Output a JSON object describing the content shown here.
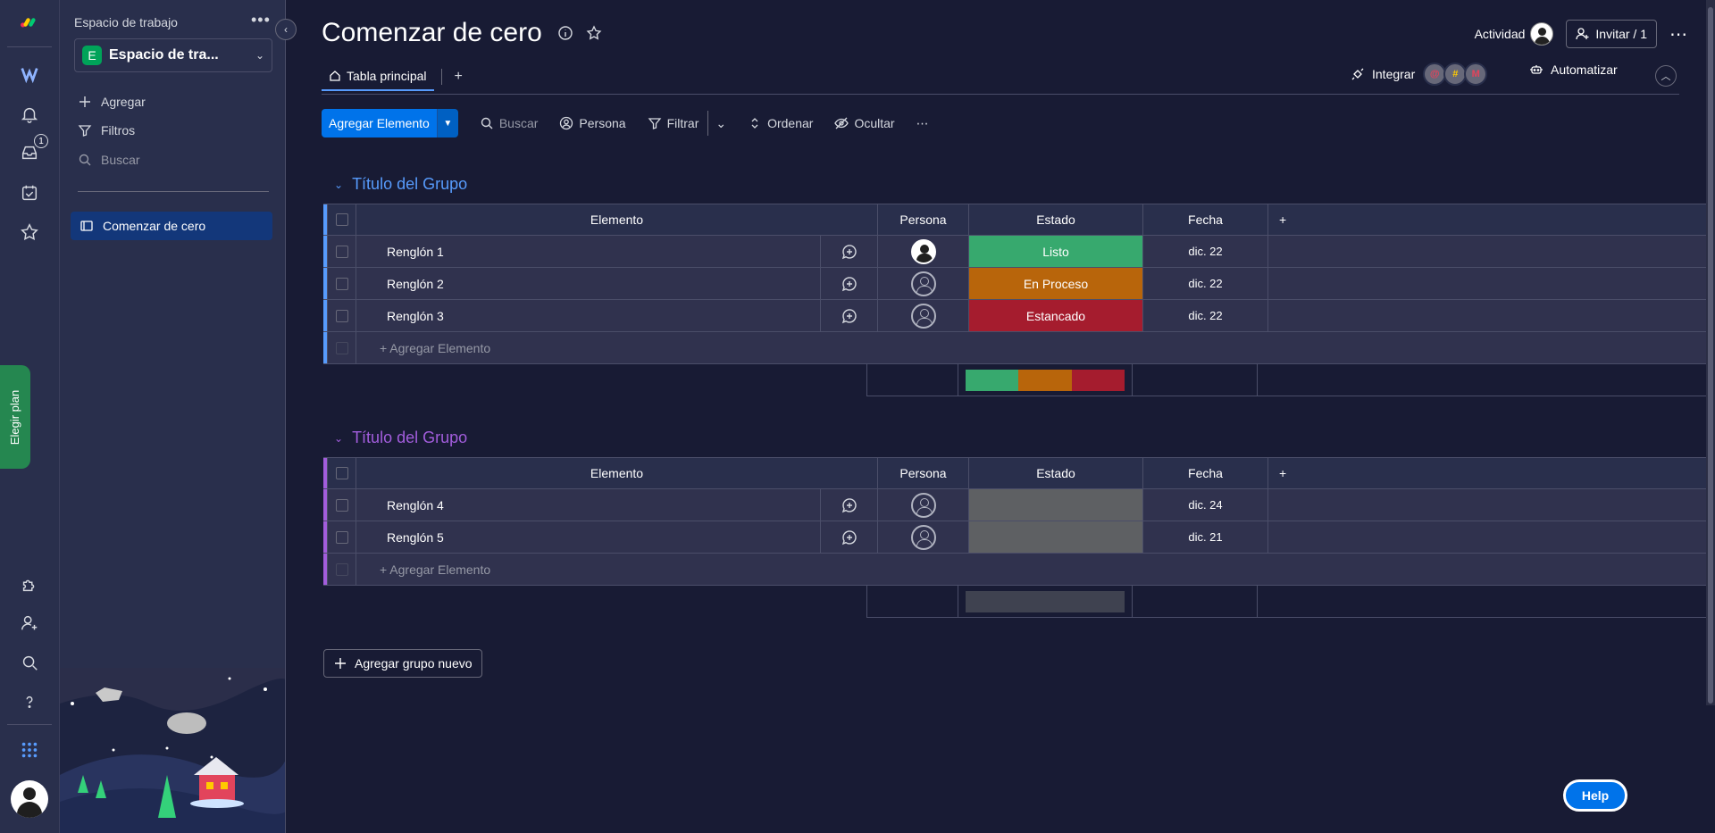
{
  "rail": {
    "inbox_badge": "1",
    "plan_label": "Elegir plan"
  },
  "workspace": {
    "label": "Espacio de trabajo",
    "letter": "E",
    "name": "Espacio de tra...",
    "actions": {
      "add": "Agregar",
      "filters": "Filtros",
      "search": "Buscar"
    },
    "board": "Comenzar de cero"
  },
  "header": {
    "title": "Comenzar de cero",
    "activity": "Actividad",
    "invite": "Invitar / 1"
  },
  "tabs": {
    "main": "Tabla principal",
    "add": "+"
  },
  "integrations": {
    "integrate": "Integrar",
    "automate": "Automatizar"
  },
  "toolbar": {
    "new_item": "Agregar Elemento",
    "search": "Buscar",
    "person": "Persona",
    "filter": "Filtrar",
    "sort": "Ordenar",
    "hide": "Ocultar"
  },
  "columns": {
    "item": "Elemento",
    "person": "Persona",
    "status": "Estado",
    "date": "Fecha"
  },
  "groups": [
    {
      "title": "Título del Grupo",
      "color": "#579bfc",
      "rows": [
        {
          "name": "Renglón 1",
          "status": "Listo",
          "status_color": "#37a96e",
          "date": "dic. 22",
          "person_filled": true
        },
        {
          "name": "Renglón 2",
          "status": "En Proceso",
          "status_color": "#b8650b",
          "date": "dic. 22",
          "person_filled": false
        },
        {
          "name": "Renglón 3",
          "status": "Estancado",
          "status_color": "#a51c2e",
          "date": "dic. 22",
          "person_filled": false
        }
      ],
      "add_item": "+ Agregar Elemento",
      "status_summary": [
        "#37a96e",
        "#b8650b",
        "#a51c2e"
      ]
    },
    {
      "title": "Título del Grupo",
      "color": "#a25ddc",
      "rows": [
        {
          "name": "Renglón 4",
          "status": "",
          "status_color": "#5e6063",
          "date": "dic. 24",
          "person_filled": false
        },
        {
          "name": "Renglón 5",
          "status": "",
          "status_color": "#5e6063",
          "date": "dic. 21",
          "person_filled": false
        }
      ],
      "add_item": "+ Agregar Elemento",
      "status_summary": [
        "#3f4250"
      ]
    }
  ],
  "add_group": "Agregar grupo nuevo",
  "help": "Help"
}
